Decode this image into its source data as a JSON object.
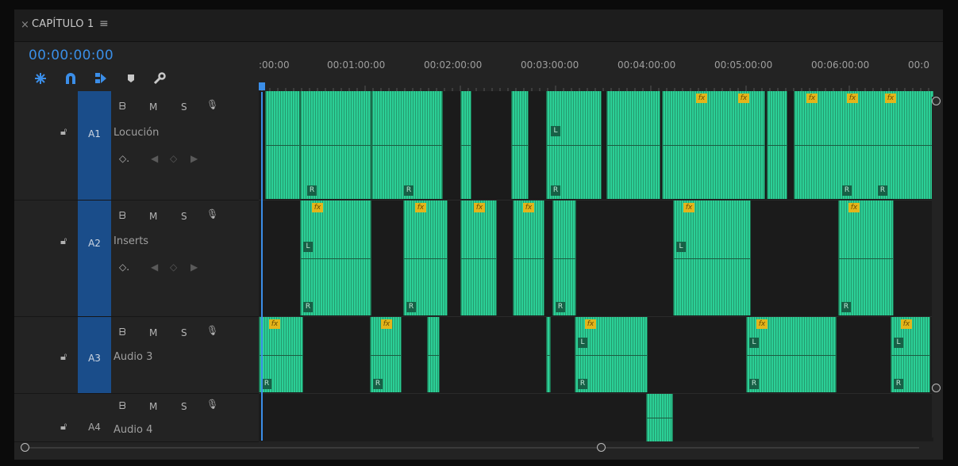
{
  "panel": {
    "tab_close": "×",
    "title": "CAPÍTULO 1",
    "menu": "≡",
    "timecode": "00:00:00:00"
  },
  "tools": [
    {
      "name": "insert-sequences-as-nests-icon"
    },
    {
      "name": "snap-magnet-icon"
    },
    {
      "name": "linked-selection-icon"
    },
    {
      "name": "add-marker-icon"
    },
    {
      "name": "timeline-settings-wrench-icon"
    }
  ],
  "ruler": {
    "labels": [
      ":00:00",
      "00:01:00:00",
      "00:02:00:00",
      "00:03:00:00",
      "00:04:00:00",
      "00:05:00:00",
      "00:06:00:00",
      "00:0"
    ]
  },
  "tracks": [
    {
      "id": "A1",
      "name": "Locución",
      "sync": "ᗷ",
      "mute": "M",
      "solo": "S",
      "keyframe": "◇.",
      "prev": "◀",
      "add": "◇",
      "next": "▶"
    },
    {
      "id": "A2",
      "name": "Inserts",
      "sync": "ᗷ",
      "mute": "M",
      "solo": "S",
      "keyframe": "◇.",
      "prev": "◀",
      "add": "◇",
      "next": "▶"
    },
    {
      "id": "A3",
      "name": "Audio 3",
      "sync": "ᗷ",
      "mute": "M",
      "solo": "S"
    },
    {
      "id": "A4",
      "name": "Audio 4",
      "sync": "ᗷ",
      "mute": "M",
      "solo": "S"
    }
  ],
  "clip_labels": {
    "fx": "fx",
    "left": "L",
    "right": "R"
  },
  "colors": {
    "accent": "#3b8ee8",
    "clip": "#2bcf96",
    "target": "#1a4d8a",
    "fx_badge": "#e3b51b"
  }
}
